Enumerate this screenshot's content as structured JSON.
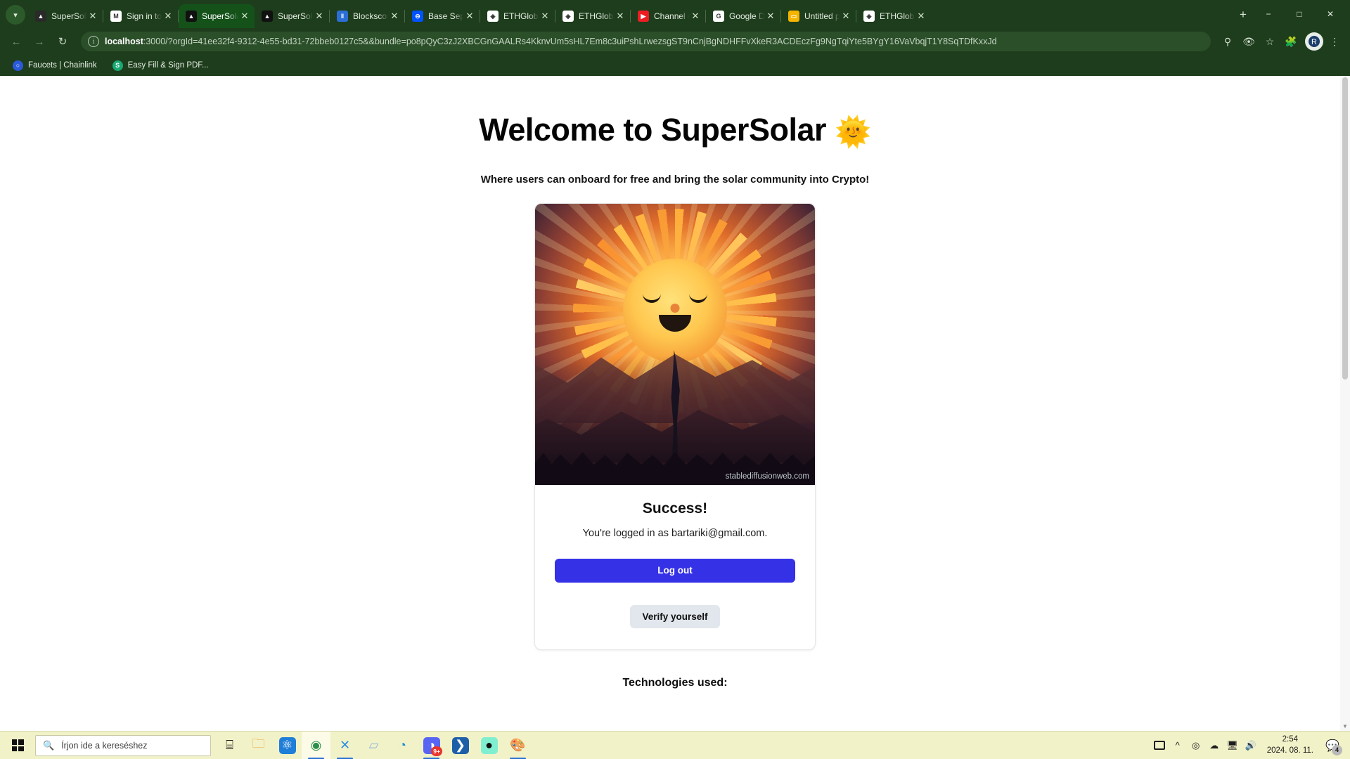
{
  "browser": {
    "tab_list_icon": "chevron-down-icon",
    "tabs": [
      {
        "title": "SuperSolar/R",
        "favicon": "supersolar-icon",
        "favicon_color": "#2a2a2a",
        "favicon_glyph": "▲",
        "active": false,
        "sep_after": true
      },
      {
        "title": "Sign in to Su",
        "favicon": "gmail-icon",
        "favicon_color": "#ffffff",
        "favicon_glyph": "M",
        "active": false,
        "sep_after": true
      },
      {
        "title": "SuperSolar",
        "favicon": "supersolar-icon",
        "favicon_color": "#111111",
        "favicon_glyph": "▲",
        "active": true,
        "sep_after": false
      },
      {
        "title": "SuperSolar",
        "favicon": "supersolar-icon",
        "favicon_color": "#111111",
        "favicon_glyph": "▲",
        "active": false,
        "sep_after": true
      },
      {
        "title": "Blockscout",
        "favicon": "blockscout-icon",
        "favicon_color": "#2b6fd6",
        "favicon_glyph": "‖",
        "active": false,
        "sep_after": true
      },
      {
        "title": "Base Sepolia",
        "favicon": "base-icon",
        "favicon_color": "#0052ff",
        "favicon_glyph": "⊖",
        "active": false,
        "sep_after": true
      },
      {
        "title": "ETHGlobal |",
        "favicon": "ethglobal-icon",
        "favicon_color": "#ffffff",
        "favicon_glyph": "◈",
        "active": false,
        "sep_after": true
      },
      {
        "title": "ETHGlobal |",
        "favicon": "ethglobal-icon",
        "favicon_color": "#ffffff",
        "favicon_glyph": "◈",
        "active": false,
        "sep_after": true
      },
      {
        "title": "Channel con",
        "favicon": "youtube-icon",
        "favicon_color": "#ed1d24",
        "favicon_glyph": "▶",
        "active": false,
        "sep_after": true
      },
      {
        "title": "Google Diák",
        "favicon": "google-icon",
        "favicon_color": "#ffffff",
        "favicon_glyph": "G",
        "active": false,
        "sep_after": true
      },
      {
        "title": "Untitled pres",
        "favicon": "slides-icon",
        "favicon_color": "#f4b400",
        "favicon_glyph": "▭",
        "active": false,
        "sep_after": true
      },
      {
        "title": "ETHGlobal",
        "favicon": "ethglobal-icon",
        "favicon_color": "#ffffff",
        "favicon_glyph": "◈",
        "active": false,
        "sep_after": false
      }
    ],
    "new_tab_label": "+",
    "window_controls": {
      "minimize": "−",
      "maximize": "□",
      "close": "✕"
    },
    "nav": {
      "back": "←",
      "forward": "→",
      "reload": "↻"
    },
    "omnibox": {
      "info_icon": "site-info-icon",
      "url_host": "localhost",
      "url_rest": ":3000/?orgId=41ee32f4-9312-4e55-bd31-72bbeb0127c5&&bundle=po8pQyC3zJ2XBCGnGAALRs4KknvUm5sHL7Em8c3uiPshLrwezsgST9nCnjBgNDHFFvXkeR3ACDEczFg9NgTqiYte5BYgY16VaVbqjT1Y8SqTDfKxxJd",
      "zoom_icon": "search-zoom-icon",
      "tracking_icon": "third-party-cookie-blocked-icon",
      "bookmark_icon": "star-icon",
      "extensions_icon": "extensions-puzzle-icon",
      "profile_icon": "profile-avatar-icon",
      "menu_icon": "three-dot-menu-icon"
    },
    "bookmarks": [
      {
        "label": "Faucets | Chainlink",
        "icon": "chainlink-icon",
        "color": "#2a5ada",
        "glyph": "○"
      },
      {
        "label": "Easy Fill & Sign PDF...",
        "icon": "smallpdf-icon",
        "color": "#19a974",
        "glyph": "S"
      }
    ]
  },
  "page": {
    "heading": "Welcome to SuperSolar",
    "heading_emoji": "🌞",
    "tagline": "Where users can onboard for free and bring the solar community into Crypto!",
    "hero": {
      "alt": "smiling-sun-tree-illustration",
      "watermark": "stablediffusionweb.com"
    },
    "card": {
      "success_title": "Success!",
      "logged_in_text": "You're logged in as bartariki@gmail.com.",
      "logout_label": "Log out",
      "verify_label": "Verify yourself"
    },
    "tech_used_heading": "Technologies used:",
    "colors": {
      "logout_button": "#3531e6",
      "verify_button": "#e2e6ed",
      "chrome_green": "#1e3d1c"
    }
  },
  "taskbar": {
    "start_label": "start-button",
    "search_placeholder": "Írjon ide a kereséshez",
    "search_icon": "magnifier-icon",
    "apps": [
      {
        "name": "task-view",
        "glyph": "⌸",
        "color": "#1d1d1d",
        "bg": "transparent",
        "active": false,
        "open": false,
        "badge": ""
      },
      {
        "name": "file-explorer",
        "glyph": "🗀",
        "color": "#e8a33d",
        "bg": "transparent",
        "active": false,
        "open": false,
        "badge": ""
      },
      {
        "name": "react-app",
        "glyph": "⚛",
        "color": "#ffffff",
        "bg": "#1f7ed8",
        "active": false,
        "open": false,
        "badge": ""
      },
      {
        "name": "google-chrome",
        "glyph": "◉",
        "color": "#2a8f4a",
        "bg": "transparent",
        "active": true,
        "open": true,
        "badge": ""
      },
      {
        "name": "vs-code",
        "glyph": "✕",
        "color": "#2a8fe0",
        "bg": "transparent",
        "active": false,
        "open": true,
        "badge": ""
      },
      {
        "name": "notepad",
        "glyph": "▱",
        "color": "#8fb6d8",
        "bg": "transparent",
        "active": false,
        "open": false,
        "badge": ""
      },
      {
        "name": "microsoft-edge",
        "glyph": "◔",
        "color": "#1b8fd4",
        "bg": "transparent",
        "active": false,
        "open": false,
        "badge": ""
      },
      {
        "name": "discord",
        "glyph": "◑",
        "color": "#ffffff",
        "bg": "#5865f2",
        "active": false,
        "open": true,
        "badge": "9+"
      },
      {
        "name": "powershell",
        "glyph": "❯",
        "color": "#ffffff",
        "bg": "#1e5fa8",
        "active": false,
        "open": false,
        "badge": ""
      },
      {
        "name": "streamlabs",
        "glyph": "●",
        "color": "#111111",
        "bg": "#80efd0",
        "active": false,
        "open": false,
        "badge": ""
      },
      {
        "name": "paint",
        "glyph": "🎨",
        "color": "#d8d8d8",
        "bg": "transparent",
        "active": false,
        "open": true,
        "badge": ""
      }
    ],
    "tray": {
      "news_icon": "news-weather-icon",
      "chevron_icon": "show-hidden-icons-icon",
      "camera_icon": "camera-privacy-icon",
      "cloud_icon": "onedrive-icon",
      "network_icon": "network-icon",
      "volume_icon": "volume-icon",
      "time": "2:54",
      "date": "2024. 08. 11.",
      "notification_icon": "action-center-icon",
      "notification_count": "4"
    }
  }
}
